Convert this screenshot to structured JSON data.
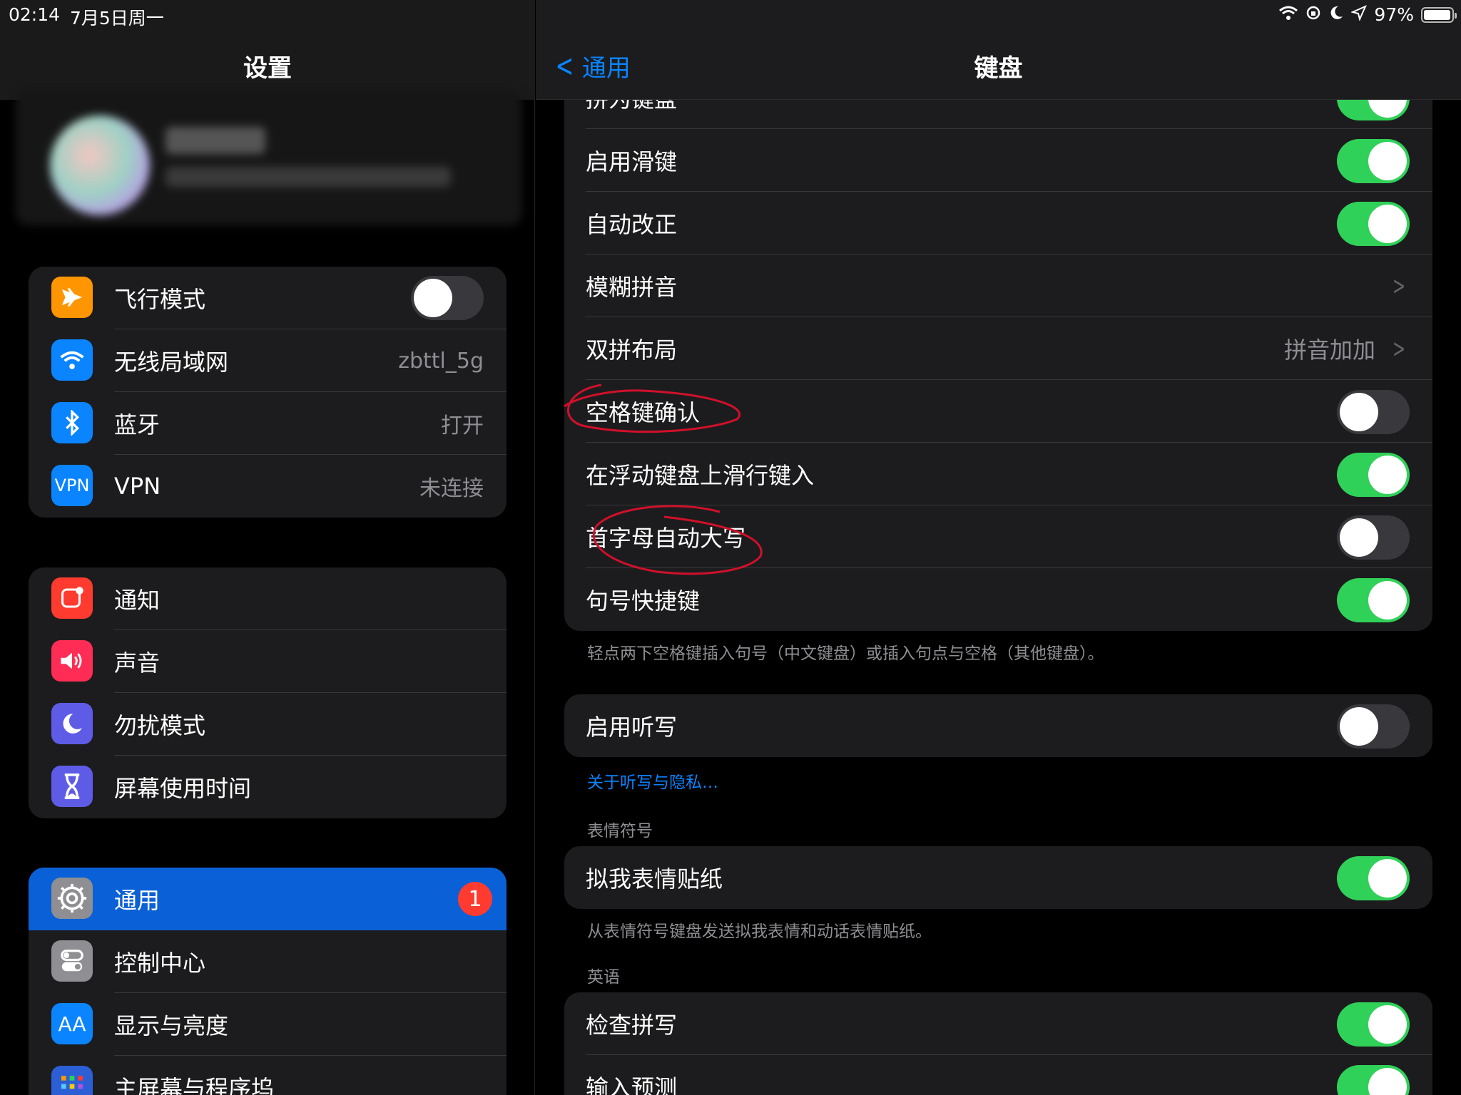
{
  "status_bar": {
    "time": "02:14",
    "date": "7月5日周一",
    "battery": "97%",
    "battery_level": 0.97
  },
  "sidebar": {
    "title": "设置",
    "groups": [
      [
        {
          "label": "飞行模式",
          "icon": "airplane-icon",
          "color": "#ff9500",
          "toggle": false
        },
        {
          "label": "无线局域网",
          "icon": "wifi-icon",
          "color": "#0a84ff",
          "value": "zbttl_5g"
        },
        {
          "label": "蓝牙",
          "icon": "bluetooth-icon",
          "color": "#0a84ff",
          "value": "打开"
        },
        {
          "label": "VPN",
          "icon": "vpn-icon",
          "color": "#0a84ff",
          "value": "未连接"
        }
      ],
      [
        {
          "label": "通知",
          "icon": "notification-icon",
          "color": "#ff3b30"
        },
        {
          "label": "声音",
          "icon": "sound-icon",
          "color": "#ff2d55"
        },
        {
          "label": "勿扰模式",
          "icon": "moon-icon",
          "color": "#5e5ce6"
        },
        {
          "label": "屏幕使用时间",
          "icon": "hourglass-icon",
          "color": "#5e5ce6"
        }
      ],
      [
        {
          "label": "通用",
          "icon": "gear-icon",
          "color": "#8e8e93",
          "badge": "1",
          "selected": true
        },
        {
          "label": "控制中心",
          "icon": "control-center-icon",
          "color": "#8e8e93"
        },
        {
          "label": "显示与亮度",
          "icon": "display-icon",
          "color": "#0a84ff"
        },
        {
          "label": "主屏幕与程序坞",
          "icon": "home-screen-icon",
          "color": "#2c5fd6"
        }
      ]
    ],
    "vpn_icon_text": "VPN",
    "display_icon_text": "AA"
  },
  "detail": {
    "back_label": "通用",
    "title": "键盘",
    "card1": [
      {
        "label": "拼为键盘",
        "toggle": true
      },
      {
        "label": "启用滑键",
        "toggle": true
      },
      {
        "label": "自动改正",
        "toggle": true
      },
      {
        "label": "模糊拼音",
        "chevron": true
      },
      {
        "label": "双拼布局",
        "value": "拼音加加",
        "chevron": true
      },
      {
        "label": "空格键确认",
        "toggle": false
      },
      {
        "label": "在浮动键盘上滑行键入",
        "toggle": true
      },
      {
        "label": "首字母自动大写",
        "toggle": false
      },
      {
        "label": "句号快捷键",
        "toggle": true
      }
    ],
    "card1_footer": "轻点两下空格键插入句号（中文键盘）或插入句点与空格（其他键盘）。",
    "dictation": {
      "label": "启用听写",
      "toggle": false
    },
    "dictation_link": "关于听写与隐私…",
    "emoji_section": "表情符号",
    "memoji": {
      "label": "拟我表情贴纸",
      "toggle": true
    },
    "memoji_footer": "从表情符号键盘发送拟我表情和动话表情贴纸。",
    "english_section": "英语",
    "english": [
      {
        "label": "检查拼写",
        "toggle": true
      },
      {
        "label": "输入预测",
        "toggle": true
      }
    ]
  },
  "colors": {
    "accent": "#0a84ff",
    "toggle_on": "#30d158",
    "toggle_off": "#39393d",
    "annotation": "#d0102a"
  }
}
